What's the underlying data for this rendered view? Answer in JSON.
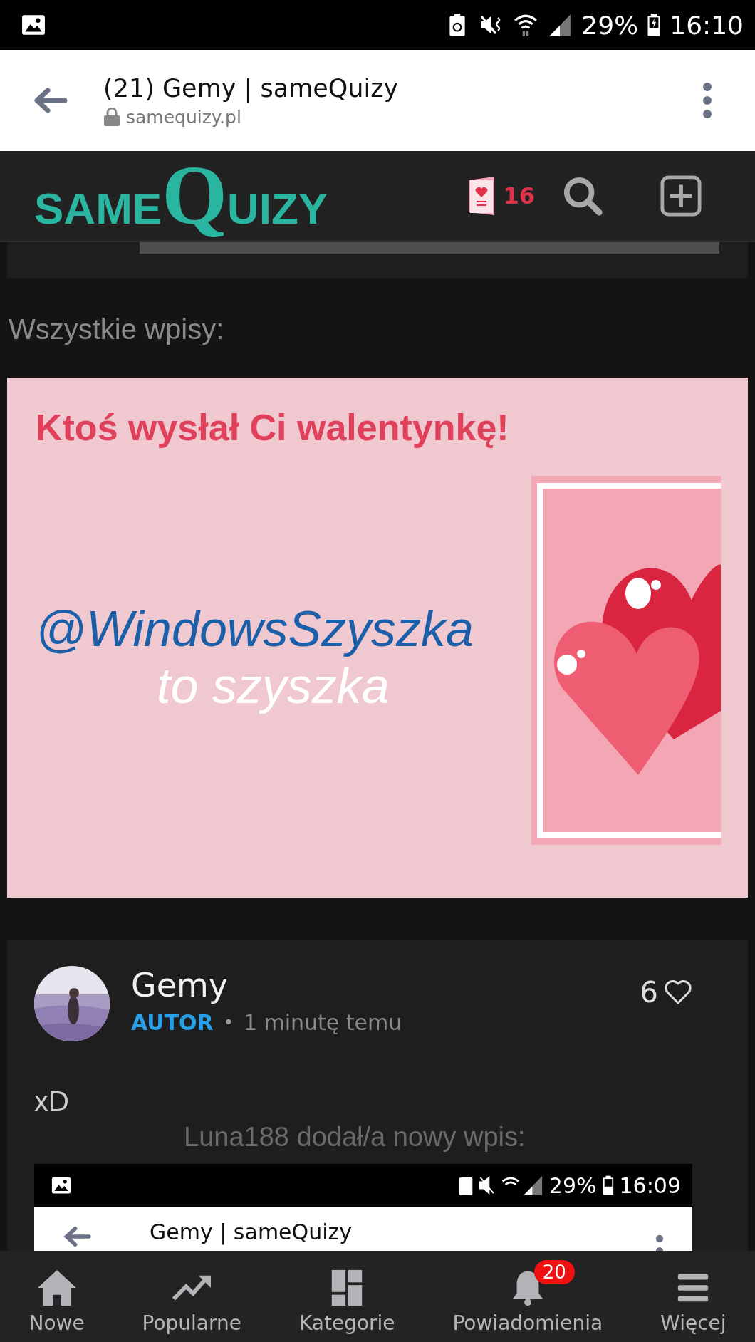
{
  "status_bar": {
    "battery": "29%",
    "time": "16:10"
  },
  "browser": {
    "title": "(21) Gemy | sameQuizy",
    "url": "samequizy.pl"
  },
  "site_header": {
    "logo_parts": [
      "SAME",
      "Q",
      "UIZY"
    ],
    "valentine_count": "16"
  },
  "section_heading": "Wszystkie wpisy:",
  "banner": {
    "title": "Ktoś wysłał Ci walentynkę!",
    "recipient": "@WindowsSzyszka",
    "message": "to szyszka"
  },
  "post": {
    "author": "Gemy",
    "role": "AUTOR",
    "separator": "•",
    "time": "1 minutę temu",
    "likes": "6",
    "liked": false,
    "text": "xD",
    "toast": "Luna188 dodał/a nowy wpis:",
    "screenshot": {
      "battery": "29%",
      "time": "16:09",
      "title": "Gemy | sameQuizy"
    }
  },
  "nav": [
    {
      "kind": "home",
      "label": "Nowe"
    },
    {
      "kind": "trend",
      "label": "Popularne"
    },
    {
      "kind": "grid",
      "label": "Kategorie"
    },
    {
      "kind": "bell",
      "label": "Powiadomienia",
      "badge": "20"
    },
    {
      "kind": "menu",
      "label": "Więcej"
    }
  ]
}
